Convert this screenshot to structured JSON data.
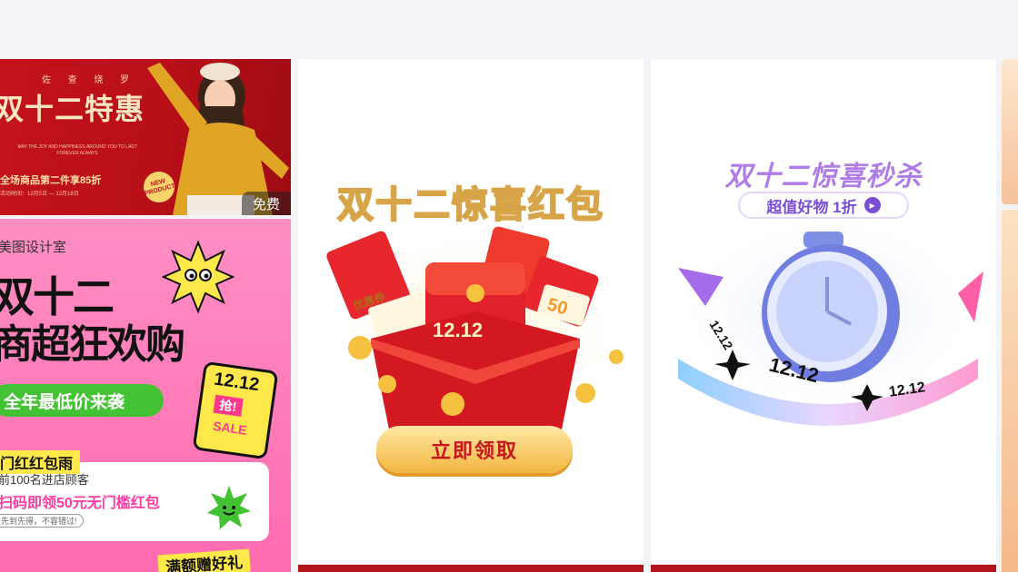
{
  "cards": {
    "card1": {
      "slogan_chars": [
        "佐",
        "查",
        "烧",
        "罗"
      ],
      "title": "双十二特惠",
      "english_line": "MAY THE JOY AND HAPPINESS AROUND YOU TO LAST FOREVER ALWAYS",
      "deal": "全场商品第二件享85折",
      "date": "活动时间：12月5日 — 12月18日",
      "new_badge": "NEW PRODUCT",
      "free_label": "免费"
    },
    "card2": {
      "studio": "美图设计室",
      "headline1": "双十二",
      "headline2": "商超狂欢购",
      "pill": "全年最低价来袭",
      "phone_date": "12.12",
      "phone_badge": "抢!",
      "phone_sale": "SALE",
      "rain": "门红红包雨",
      "line1": "前100名进店顾客",
      "line2": "扫码即领50元无门槛红包",
      "note": "先到先得，不容错过!",
      "gift": "满额赠好礼"
    },
    "card3": {
      "title": "双十二惊喜红包",
      "coupon": "优惠券",
      "envelope_date": "12.12",
      "amount": "50",
      "button": "立即领取"
    },
    "card4": {
      "title": "双十二惊喜秒杀",
      "pill": "超值好物 1折",
      "ring_text": "12.12"
    }
  },
  "colors": {
    "page_bg": "#f3f4f8",
    "red": "#c4121c",
    "pink": "#ff6bb0",
    "yellow": "#ffe94a",
    "green": "#43c234",
    "purple": "#7a4ed6",
    "gold": "#f2b640"
  }
}
